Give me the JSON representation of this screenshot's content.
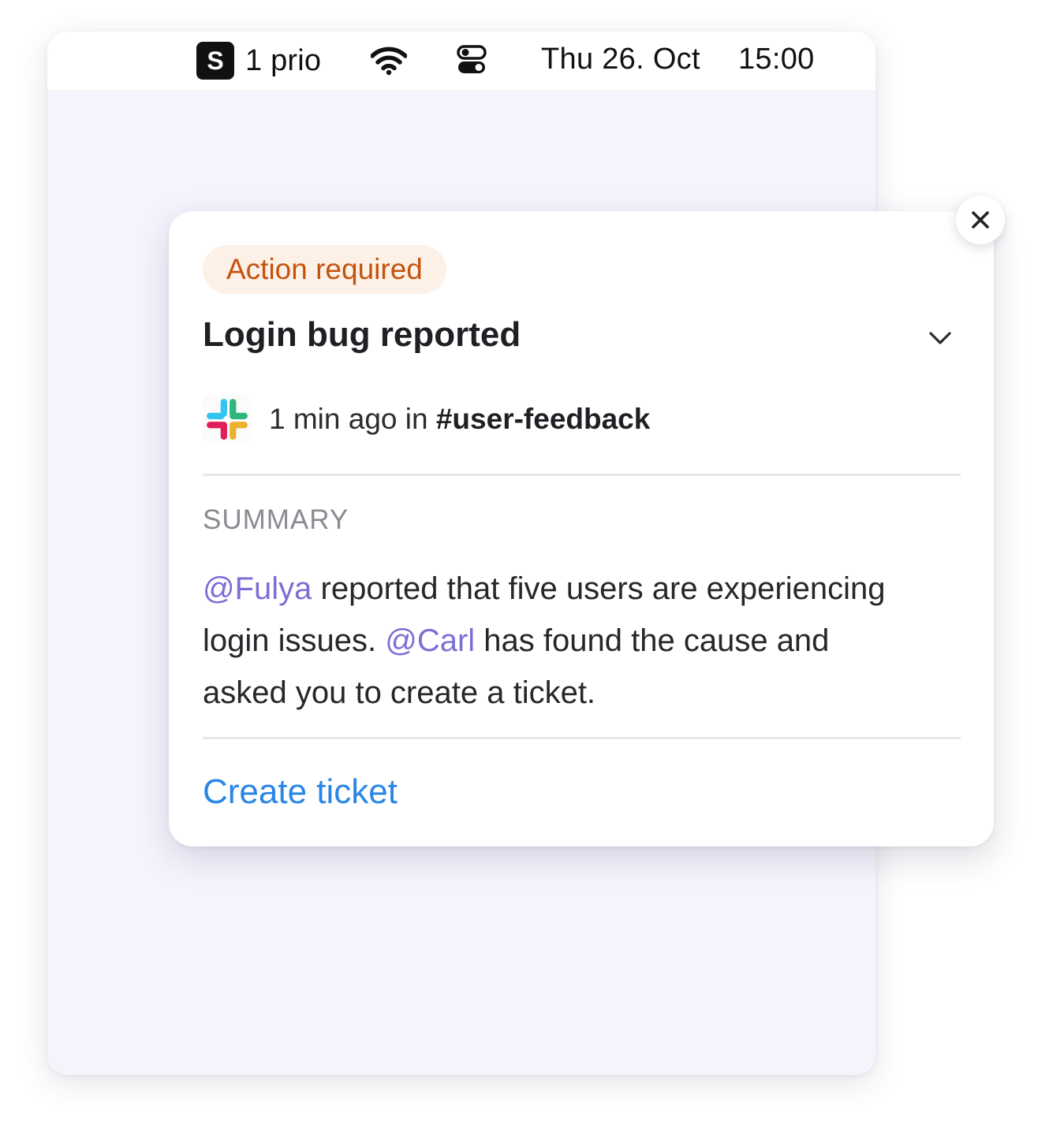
{
  "menubar": {
    "app_icon_letter": "S",
    "prio_label": "1 prio",
    "wifi_icon": "wifi-icon",
    "control_center_icon": "control-center-icon",
    "date": "Thu 26. Oct",
    "time": "15:00"
  },
  "notification": {
    "badge": "Action required",
    "title": "Login bug reported",
    "meta": {
      "source_icon": "slack-icon",
      "time_ago": "1 min ago in ",
      "channel": "#user-feedback"
    },
    "summary_label": "SUMMARY",
    "summary": {
      "mention_1": "@Fulya",
      "text_1": " reported that five users are experiencing login issues. ",
      "mention_2": "@Carl",
      "text_2": " has found the cause and asked you to create a ticket."
    },
    "action_label": "Create ticket",
    "colors": {
      "badge_text": "#c4530e",
      "badge_bg": "#fdf1e7",
      "mention": "#7b6fd6",
      "action": "#2a86e6"
    }
  }
}
